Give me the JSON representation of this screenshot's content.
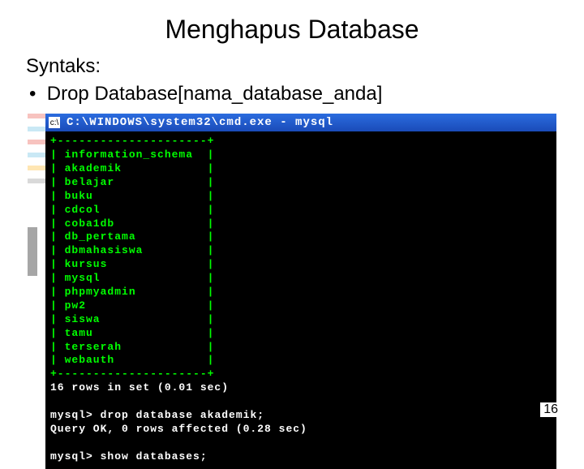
{
  "title": "Menghapus Database",
  "syntaks_label": "Syntaks:",
  "bullet_text": "Drop Database[nama_database_anda]",
  "terminal": {
    "titlebar": "C:\\WINDOWS\\system32\\cmd.exe - mysql",
    "border": "+---------------------+",
    "databases": [
      "information_schema",
      "akademik",
      "belajar",
      "buku",
      "cdcol",
      "coba1db",
      "db_pertama",
      "dbmahasiswa",
      "kursus",
      "mysql",
      "phpmyadmin",
      "pw2",
      "siswa",
      "tamu",
      "terserah",
      "webauth"
    ],
    "rows_status": "16 rows in set (0.01 sec)",
    "prompt": "mysql>",
    "drop_cmd": "drop database akademik;",
    "drop_result": "Query OK, 0 rows affected (0.28 sec)",
    "show_cmd": "show databases;"
  },
  "page_number": "16"
}
